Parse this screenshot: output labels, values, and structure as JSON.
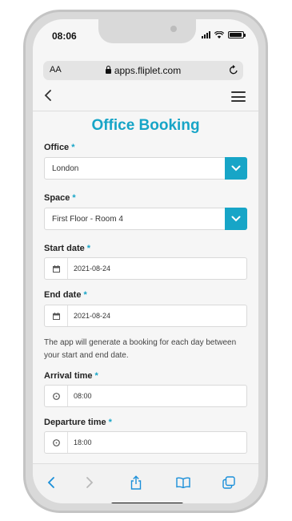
{
  "status_bar": {
    "time": "08:06"
  },
  "browser": {
    "text_size": "AA",
    "url": "apps.fliplet.com"
  },
  "page": {
    "title": "Office Booking"
  },
  "form": {
    "office": {
      "label": "Office",
      "required_mark": "*",
      "value": "London"
    },
    "space": {
      "label": "Space",
      "required_mark": "*",
      "value": "First Floor - Room 4"
    },
    "start_date": {
      "label": "Start date",
      "required_mark": "*",
      "value": "2021-08-24"
    },
    "end_date": {
      "label": "End date",
      "required_mark": "*",
      "value": "2021-08-24"
    },
    "helper_text": "The app will generate a booking for each day between your start and end date.",
    "arrival_time": {
      "label": "Arrival time",
      "required_mark": "*",
      "value": "08:00"
    },
    "departure_time": {
      "label": "Departure time",
      "required_mark": "*",
      "value": "18:00"
    }
  },
  "icons": {
    "back": "chevron-left-icon",
    "menu": "hamburger-icon",
    "dropdown": "chevron-down-icon",
    "calendar": "calendar-icon",
    "clock": "clock-icon",
    "lock": "lock-icon",
    "reload": "reload-icon",
    "toolbar": [
      "back-arrow-icon",
      "forward-arrow-icon",
      "share-icon",
      "bookmarks-icon",
      "tabs-icon"
    ]
  },
  "colors": {
    "accent": "#17a5c7"
  }
}
